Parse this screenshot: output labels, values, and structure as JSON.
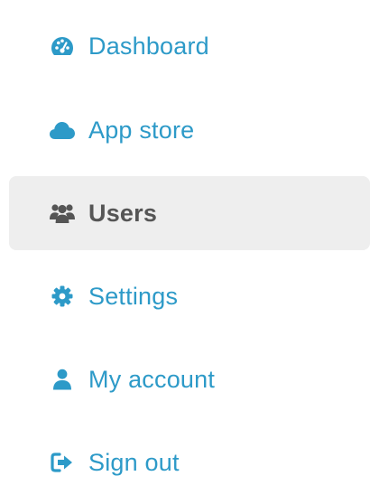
{
  "colors": {
    "link": "#2d9ac8",
    "active_text": "#555555",
    "active_background": "#eeeeee"
  },
  "nav": {
    "items": [
      {
        "label": "Dashboard",
        "icon": "dashboard-icon",
        "active": false
      },
      {
        "label": "App store",
        "icon": "cloud-icon",
        "active": false
      },
      {
        "label": "Users",
        "icon": "users-icon",
        "active": true
      },
      {
        "label": "Settings",
        "icon": "gear-icon",
        "active": false
      },
      {
        "label": "My account",
        "icon": "user-icon",
        "active": false
      },
      {
        "label": "Sign out",
        "icon": "sign-out-icon",
        "active": false
      }
    ]
  }
}
